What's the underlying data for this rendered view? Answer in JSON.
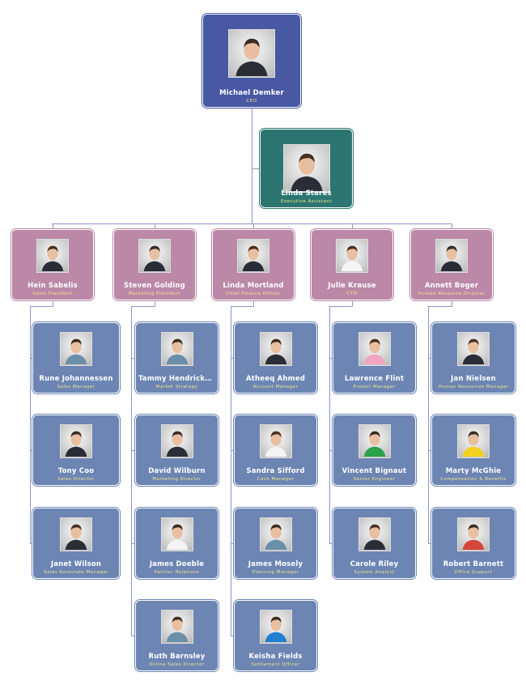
{
  "colors": {
    "ceo": "#4858a3",
    "assistant": "#2d7571",
    "director": "#bb88a7",
    "staff": "#6c85b3",
    "connector": "#8b97c6",
    "title_text": "#f4e88a"
  },
  "ceo": {
    "name": "Michael Demker",
    "title": "CEO",
    "photo": "man-suit-gray-hair"
  },
  "assistant": {
    "name": "Linda Stares",
    "title": "Executive Assistant",
    "photo": "woman-long-dark-hair"
  },
  "departments": [
    {
      "head": {
        "name": "Hein Sabelis",
        "title": "Sales President",
        "photo": "woman-dark-suit"
      },
      "staff": [
        {
          "name": "Rune Johannessen",
          "title": "Sales Manager",
          "photo": "man-casual"
        },
        {
          "name": "Tony Coo",
          "title": "Sales Director",
          "photo": "man-suit"
        },
        {
          "name": "Janet Wilson",
          "title": "Sales Associate Manager",
          "photo": "woman-glasses"
        }
      ]
    },
    {
      "head": {
        "name": "Steven Golding",
        "title": "Marketing President",
        "photo": "man-suit"
      },
      "staff": [
        {
          "name": "Tammy Hendricks...",
          "title": "Market Strategy",
          "photo": "man-casual"
        },
        {
          "name": "David Wilburn",
          "title": "Marketing Director",
          "photo": "man-glasses"
        },
        {
          "name": "James Doeble",
          "title": "Partner Relations",
          "photo": "man-white-shirt"
        },
        {
          "name": "Ruth Barnsley",
          "title": "Online Sales Director",
          "photo": "man-shirt"
        }
      ]
    },
    {
      "head": {
        "name": "Linda Mortland",
        "title": "Chief Finance Officer",
        "photo": "woman-suit"
      },
      "staff": [
        {
          "name": "Atheeq Ahmed",
          "title": "Account Manager",
          "photo": "man-suit-gray-hair"
        },
        {
          "name": "Sandra Sifford",
          "title": "Cash Manager",
          "photo": "woman-blonde"
        },
        {
          "name": "James Mosely",
          "title": "Planning Manager",
          "photo": "man-casual"
        },
        {
          "name": "Keisha Fields",
          "title": "Settlement Officer",
          "photo": "man-blue-shirt"
        }
      ]
    },
    {
      "head": {
        "name": "Julie Krause",
        "title": "CTO",
        "photo": "woman-blonde"
      },
      "staff": [
        {
          "name": "Lawrence Flint",
          "title": "Project Manager",
          "photo": "woman-pink-shirt"
        },
        {
          "name": "Vincent Bignaut",
          "title": "Senior Engineer",
          "photo": "man-green-shirt"
        },
        {
          "name": "Carole Riley",
          "title": "System Analyst",
          "photo": "woman-red-hair"
        }
      ]
    },
    {
      "head": {
        "name": "Annett Boger",
        "title": "Human Resource Director",
        "photo": "man-suit"
      },
      "staff": [
        {
          "name": "Jan Nielsen",
          "title": "Human Resources Manager",
          "photo": "woman-curly-hair"
        },
        {
          "name": "Marty McGhie",
          "title": "Compensation & Benefits",
          "photo": "man-yellow-shirt"
        },
        {
          "name": "Robert Barnett",
          "title": "Office Support",
          "photo": "man-red-shirt"
        }
      ]
    }
  ]
}
